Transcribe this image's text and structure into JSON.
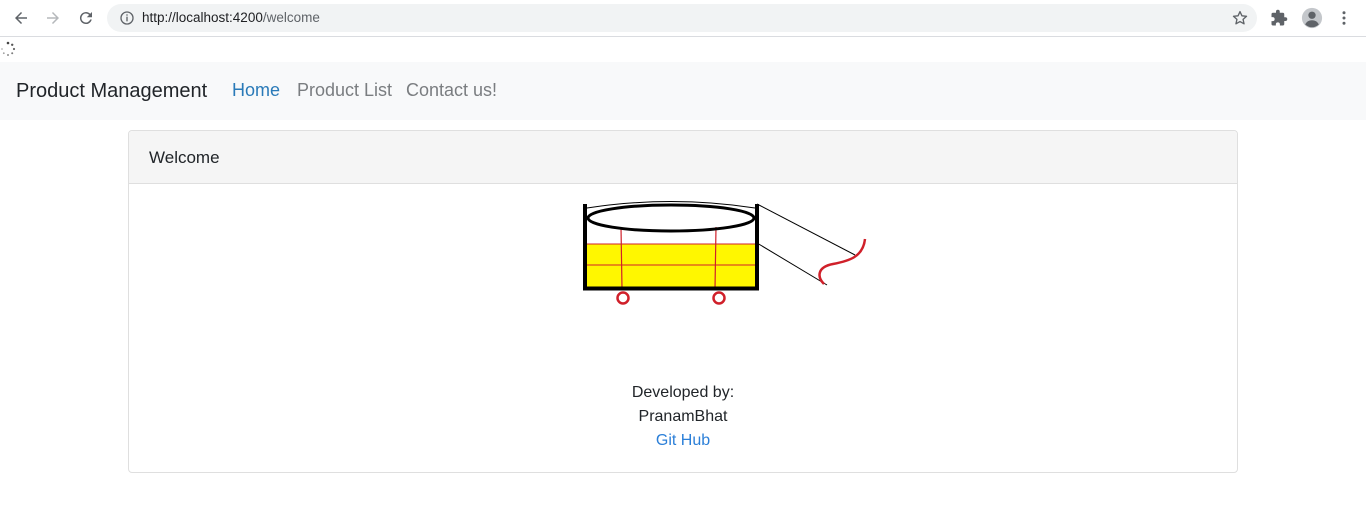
{
  "browser": {
    "url_host": "http://localhost:4200",
    "url_path": "/welcome"
  },
  "navbar": {
    "brand": "Product Management",
    "links": [
      {
        "label": "Home",
        "active": true
      },
      {
        "label": "Product List",
        "active": false
      },
      {
        "label": "Contact us!",
        "active": false
      }
    ]
  },
  "card": {
    "header": "Welcome",
    "developed_by_label": "Developed by:",
    "developer_name": "PranamBhat",
    "github_link": "Git Hub"
  },
  "colors": {
    "active_link": "#2a7ab8",
    "muted_link": "#7a7d80",
    "link": "#2b7fd8",
    "cart_fill": "#fff700",
    "cart_accent": "#d0202a"
  },
  "icons": [
    "back-icon",
    "forward-icon",
    "reload-icon",
    "info-icon",
    "star-icon",
    "extensions-icon",
    "profile-icon",
    "menu-icon",
    "loading-spinner-icon"
  ]
}
